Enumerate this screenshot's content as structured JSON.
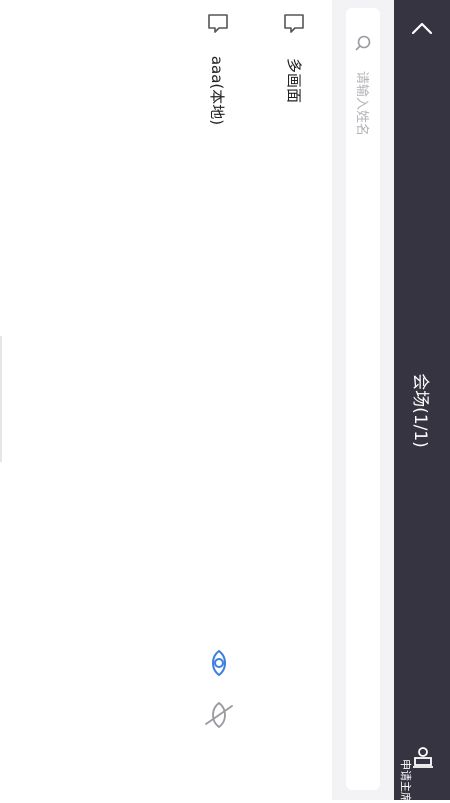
{
  "header": {
    "title": "会场(1/1)",
    "apply_chair_label": "申请主席"
  },
  "search": {
    "placeholder": "请输入姓名"
  },
  "members": [
    {
      "name": "多画面",
      "icon": "screen-icon"
    },
    {
      "name": "aaa(本地)",
      "icon": "screen-icon"
    }
  ],
  "controls": {
    "eye_icon": "eye-icon",
    "eye_off_icon": "eye-off-icon"
  },
  "colors": {
    "header_bg": "#373442",
    "accent": "#3d7fe0",
    "search_bg": "#f3f3f5"
  }
}
